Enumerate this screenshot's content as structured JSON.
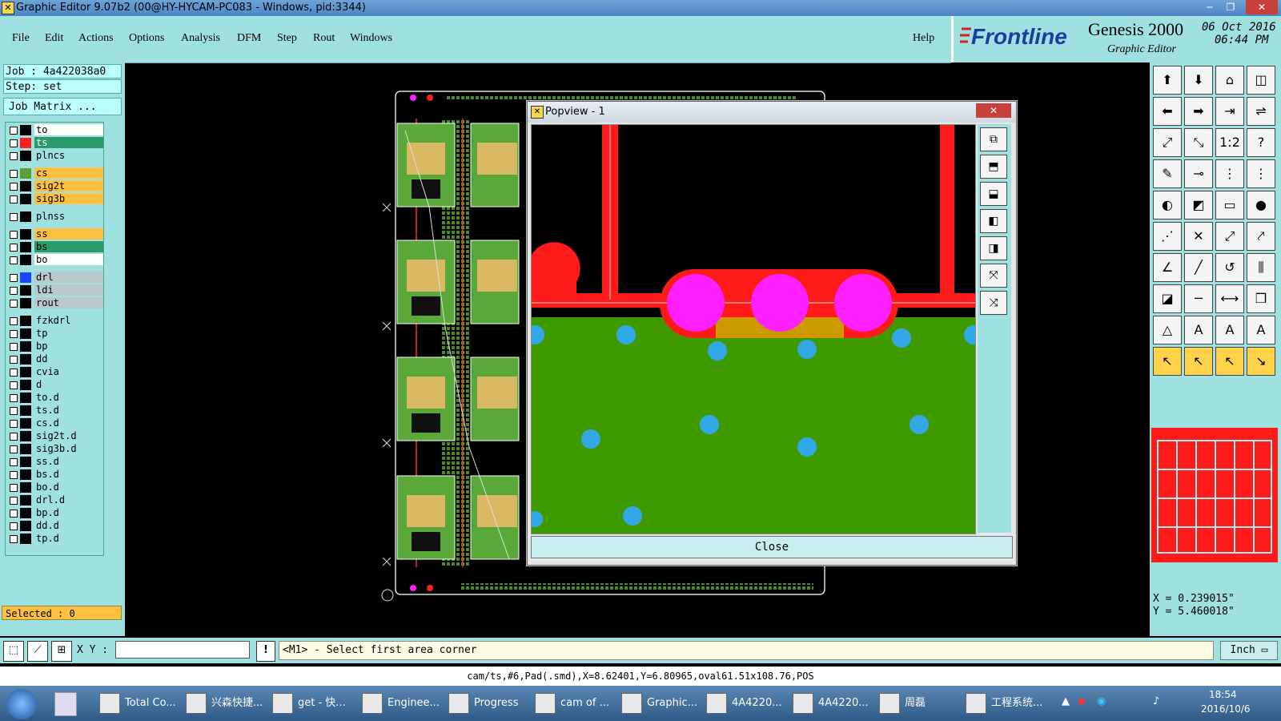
{
  "window": {
    "title": "Graphic Editor 9.07b2 (00@HY-HYCAM-PC083 - Windows, pid:3344)",
    "controls": [
      "─",
      "❐",
      "✕"
    ]
  },
  "menu": {
    "items": [
      "File",
      "Edit",
      "Actions",
      "Options",
      "Analysis",
      "DFM",
      "Step",
      "Rout",
      "Windows"
    ],
    "help": "Help"
  },
  "brand": {
    "logo": "Frontline",
    "product": "Genesis 2000",
    "subtitle": "Graphic Editor",
    "date": "06 Oct 2016",
    "time": "06:44 PM"
  },
  "left": {
    "job": "Job : 4a422038a0",
    "step": "Step: set",
    "job_matrix": "Job Matrix ...",
    "selected": "Selected : 0",
    "layers": [
      {
        "name": "to",
        "color": "#ffffff",
        "swatch": "#000000"
      },
      {
        "name": "ts",
        "color": "#2a9a6a",
        "swatch": "#ff2020",
        "active": true
      },
      {
        "name": "plncs",
        "color": "#9fe0e0",
        "swatch": "#000000"
      },
      {
        "name": "cs",
        "color": "#ffc040",
        "swatch": "#5aa030"
      },
      {
        "name": "sig2t",
        "color": "#ffc040",
        "swatch": "#000000"
      },
      {
        "name": "sig3b",
        "color": "#ffc040",
        "swatch": "#000000"
      },
      {
        "name": "plnss",
        "color": "#9fe0e0",
        "swatch": "#000000"
      },
      {
        "name": "ss",
        "color": "#ffc040",
        "swatch": "#000000"
      },
      {
        "name": "bs",
        "color": "#2a9a6a",
        "swatch": "#000000"
      },
      {
        "name": "bo",
        "color": "#ffffff",
        "swatch": "#000000"
      },
      {
        "name": "drl",
        "color": "#b8c8cc",
        "swatch": "#2040ff"
      },
      {
        "name": "ldi",
        "color": "#b8c8cc",
        "swatch": "#000000"
      },
      {
        "name": "rout",
        "color": "#b8c8cc",
        "swatch": "#000000"
      },
      {
        "name": "fzkdrl",
        "color": "#9fe0e0",
        "swatch": "#000000"
      },
      {
        "name": "tp",
        "color": "#9fe0e0",
        "swatch": "#000000"
      },
      {
        "name": "bp",
        "color": "#9fe0e0",
        "swatch": "#000000"
      },
      {
        "name": "dd",
        "color": "#9fe0e0",
        "swatch": "#000000"
      },
      {
        "name": "cvia",
        "color": "#9fe0e0",
        "swatch": "#000000"
      },
      {
        "name": "d",
        "color": "#9fe0e0",
        "swatch": "#000000"
      },
      {
        "name": "to.d",
        "color": "#9fe0e0",
        "swatch": "#000000"
      },
      {
        "name": "ts.d",
        "color": "#9fe0e0",
        "swatch": "#000000"
      },
      {
        "name": "cs.d",
        "color": "#9fe0e0",
        "swatch": "#000000"
      },
      {
        "name": "sig2t.d",
        "color": "#9fe0e0",
        "swatch": "#000000"
      },
      {
        "name": "sig3b.d",
        "color": "#9fe0e0",
        "swatch": "#000000"
      },
      {
        "name": "ss.d",
        "color": "#9fe0e0",
        "swatch": "#000000"
      },
      {
        "name": "bs.d",
        "color": "#9fe0e0",
        "swatch": "#000000"
      },
      {
        "name": "bo.d",
        "color": "#9fe0e0",
        "swatch": "#000000"
      },
      {
        "name": "drl.d",
        "color": "#9fe0e0",
        "swatch": "#000000"
      },
      {
        "name": "bp.d",
        "color": "#9fe0e0",
        "swatch": "#000000"
      },
      {
        "name": "dd.d",
        "color": "#9fe0e0",
        "swatch": "#000000"
      },
      {
        "name": "tp.d",
        "color": "#9fe0e0",
        "swatch": "#000000"
      }
    ]
  },
  "popview": {
    "title": "Popview - 1",
    "close": "Close"
  },
  "coords": {
    "x": "X = 0.239015\"",
    "y": "Y = 5.460018\""
  },
  "command": {
    "xy_label": "X Y :",
    "xy_value": "",
    "prompt": "<M1> - Select first area corner",
    "units": "Inch"
  },
  "status": "cam/ts,#6,Pad(.smd),X=8.62401,Y=6.80965,oval61.51x108.76,POS",
  "taskbar": {
    "items": [
      "Total Co...",
      "兴森快捷...",
      "get - 快...",
      "Enginee...",
      "Progress",
      "cam of ...",
      "Graphic...",
      "4A4220...",
      "4A4220...",
      "周磊",
      "工程系统..."
    ],
    "time": "18:54",
    "date": "2016/10/6"
  }
}
